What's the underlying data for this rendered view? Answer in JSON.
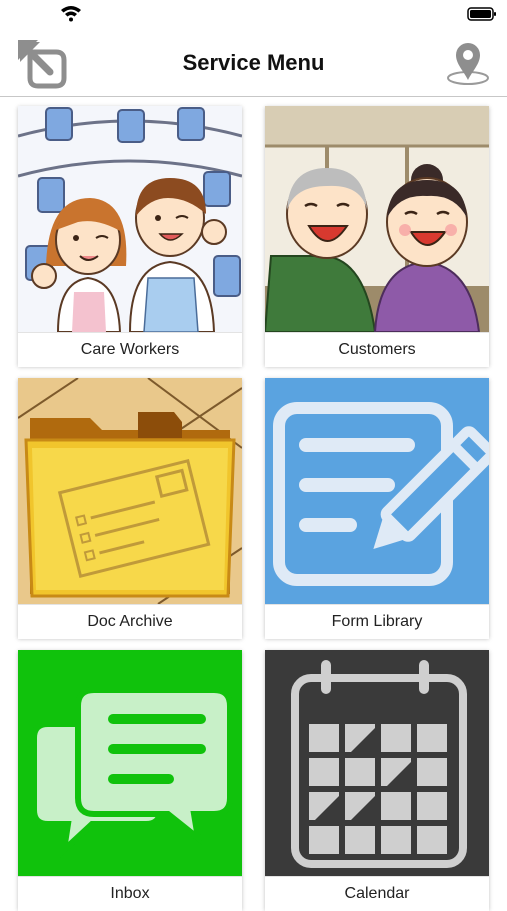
{
  "status_bar": {
    "wifi_icon": "wifi-icon",
    "battery_icon": "battery-icon"
  },
  "nav": {
    "title": "Service Menu",
    "back_icon": "exit-arrow-icon",
    "location_icon": "map-pin-icon"
  },
  "menu": {
    "items": [
      {
        "label": "Care Workers",
        "icon": "care-workers-illustration"
      },
      {
        "label": "Customers",
        "icon": "customers-illustration"
      },
      {
        "label": "Doc Archive",
        "icon": "folder-icon"
      },
      {
        "label": "Form Library",
        "icon": "form-edit-icon"
      },
      {
        "label": "Inbox",
        "icon": "chat-bubbles-icon"
      },
      {
        "label": "Calendar",
        "icon": "calendar-icon"
      }
    ]
  },
  "colors": {
    "form_library_bg": "#5aa3e0",
    "inbox_bg": "#10c20c",
    "calendar_bg": "#3a3a3a",
    "doc_archive_bg": "#e9c88b"
  }
}
